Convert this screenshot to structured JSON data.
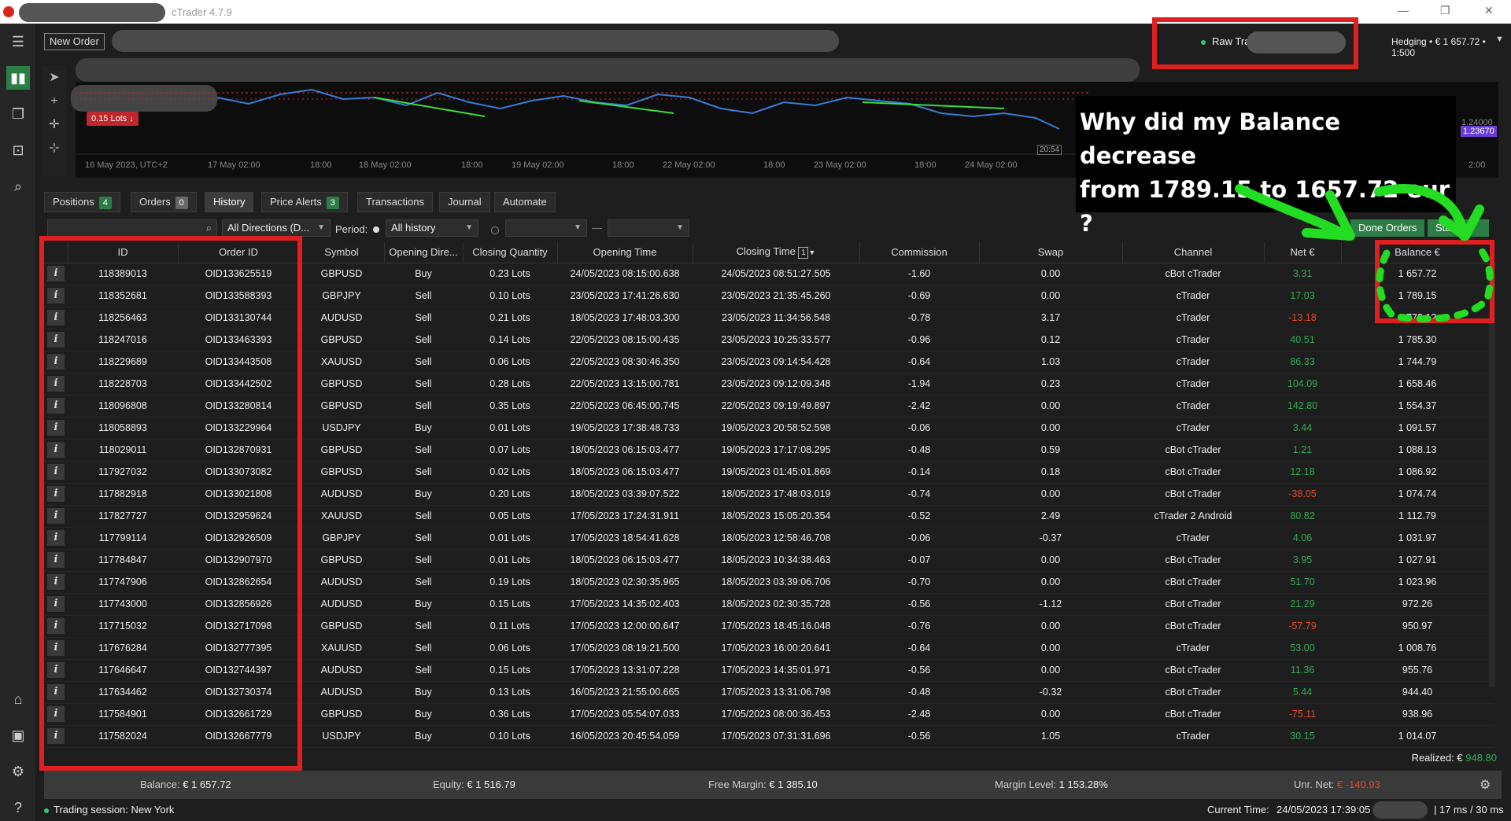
{
  "app": {
    "title": "cTrader 4.7.9"
  },
  "topbar": {
    "new_order": "New Order",
    "account_label": "Raw Trading",
    "account_suffix": "Hedging • € 1 657.72 • 1:500"
  },
  "chart": {
    "lots_badge": "0.15 Lots ↓",
    "time_labels": [
      "16 May 2023, UTC+2",
      "17 May 02:00",
      "18:00",
      "18 May 02:00",
      "18:00",
      "19 May 02:00",
      "18:00",
      "22 May 02:00",
      "18:00",
      "23 May 02:00",
      "18:00",
      "24 May 02:00"
    ],
    "price_label": "1.24000",
    "price_marker": "1.23670",
    "time_marker": "20:54",
    "axis_time_end": "2:00"
  },
  "annotation": {
    "line1": "Why did my Balance decrease",
    "line2": "from 1789.15 to 1657.72 eur ?"
  },
  "tabs": [
    {
      "label": "Positions",
      "badge": "4"
    },
    {
      "label": "Orders",
      "badge": "0"
    },
    {
      "label": "History",
      "badge": ""
    },
    {
      "label": "Price Alerts",
      "badge": "3"
    },
    {
      "label": "Transactions",
      "badge": ""
    },
    {
      "label": "Journal",
      "badge": ""
    },
    {
      "label": "Automate",
      "badge": ""
    }
  ],
  "filters": {
    "direction": "All Directions (D...",
    "period_label": "Period:",
    "period_value": "All history",
    "done_orders": "Done Orders",
    "statement": "Stateme"
  },
  "columns": [
    "ID",
    "Order ID",
    "Symbol",
    "Opening Dire...",
    "Closing Quantity",
    "Opening Time",
    "Closing Time",
    "Commission",
    "Swap",
    "Channel",
    "Net €",
    "Balance €"
  ],
  "sort_badge": "1",
  "rows": [
    [
      "118389013",
      "OID133625519",
      "GBPUSD",
      "Buy",
      "0.23 Lots",
      "24/05/2023 08:15:00.638",
      "24/05/2023 08:51:27.505",
      "-1.60",
      "0.00",
      "cBot cTrader",
      "3.31",
      "1 657.72"
    ],
    [
      "118352681",
      "OID133588393",
      "GBPJPY",
      "Sell",
      "0.10 Lots",
      "23/05/2023 17:41:26.630",
      "23/05/2023 21:35:45.260",
      "-0.69",
      "0.00",
      "cTrader",
      "17.03",
      "1 789.15"
    ],
    [
      "118256463",
      "OID133130744",
      "AUDUSD",
      "Sell",
      "0.21 Lots",
      "18/05/2023 17:48:03.300",
      "23/05/2023 11:34:56.548",
      "-0.78",
      "3.17",
      "cTrader",
      "-13.18",
      "1 772.12"
    ],
    [
      "118247016",
      "OID133463393",
      "GBPUSD",
      "Sell",
      "0.14 Lots",
      "22/05/2023 08:15:00.435",
      "23/05/2023 10:25:33.577",
      "-0.96",
      "0.12",
      "cTrader",
      "40.51",
      "1 785.30"
    ],
    [
      "118229689",
      "OID133443508",
      "XAUUSD",
      "Sell",
      "0.06 Lots",
      "22/05/2023 08:30:46.350",
      "23/05/2023 09:14:54.428",
      "-0.64",
      "1.03",
      "cTrader",
      "86.33",
      "1 744.79"
    ],
    [
      "118228703",
      "OID133442502",
      "GBPUSD",
      "Sell",
      "0.28 Lots",
      "22/05/2023 13:15:00.781",
      "23/05/2023 09:12:09.348",
      "-1.94",
      "0.23",
      "cTrader",
      "104.09",
      "1 658.46"
    ],
    [
      "118096808",
      "OID133280814",
      "GBPUSD",
      "Sell",
      "0.35 Lots",
      "22/05/2023 06:45:00.745",
      "22/05/2023 09:19:49.897",
      "-2.42",
      "0.00",
      "cTrader",
      "142.80",
      "1 554.37"
    ],
    [
      "118058893",
      "OID133229964",
      "USDJPY",
      "Buy",
      "0.01 Lots",
      "19/05/2023 17:38:48.733",
      "19/05/2023 20:58:52.598",
      "-0.06",
      "0.00",
      "cTrader",
      "3.44",
      "1 091.57"
    ],
    [
      "118029011",
      "OID132870931",
      "GBPUSD",
      "Sell",
      "0.07 Lots",
      "18/05/2023 06:15:03.477",
      "19/05/2023 17:17:08.295",
      "-0.48",
      "0.59",
      "cBot cTrader",
      "1.21",
      "1 088.13"
    ],
    [
      "117927032",
      "OID133073082",
      "GBPUSD",
      "Sell",
      "0.02 Lots",
      "18/05/2023 06:15:03.477",
      "19/05/2023 01:45:01.869",
      "-0.14",
      "0.18",
      "cBot cTrader",
      "12.18",
      "1 086.92"
    ],
    [
      "117882918",
      "OID133021808",
      "AUDUSD",
      "Buy",
      "0.20 Lots",
      "18/05/2023 03:39:07.522",
      "18/05/2023 17:48:03.019",
      "-0.74",
      "0.00",
      "cBot cTrader",
      "-38.05",
      "1 074.74"
    ],
    [
      "117827727",
      "OID132959624",
      "XAUUSD",
      "Sell",
      "0.05 Lots",
      "17/05/2023 17:24:31.911",
      "18/05/2023 15:05:20.354",
      "-0.52",
      "2.49",
      "cTrader 2 Android",
      "80.82",
      "1 112.79"
    ],
    [
      "117799114",
      "OID132926509",
      "GBPJPY",
      "Sell",
      "0.01 Lots",
      "17/05/2023 18:54:41.628",
      "18/05/2023 12:58:46.708",
      "-0.06",
      "-0.37",
      "cTrader",
      "4.06",
      "1 031.97"
    ],
    [
      "117784847",
      "OID132907970",
      "GBPUSD",
      "Sell",
      "0.01 Lots",
      "18/05/2023 06:15:03.477",
      "18/05/2023 10:34:38.463",
      "-0.07",
      "0.00",
      "cBot cTrader",
      "3.95",
      "1 027.91"
    ],
    [
      "117747906",
      "OID132862654",
      "AUDUSD",
      "Sell",
      "0.19 Lots",
      "18/05/2023 02:30:35.965",
      "18/05/2023 03:39:06.706",
      "-0.70",
      "0.00",
      "cBot cTrader",
      "51.70",
      "1 023.96"
    ],
    [
      "117743000",
      "OID132856926",
      "AUDUSD",
      "Buy",
      "0.15 Lots",
      "17/05/2023 14:35:02.403",
      "18/05/2023 02:30:35.728",
      "-0.56",
      "-1.12",
      "cBot cTrader",
      "21.29",
      "972.26"
    ],
    [
      "117715032",
      "OID132717098",
      "GBPUSD",
      "Sell",
      "0.11 Lots",
      "17/05/2023 12:00:00.647",
      "17/05/2023 18:45:16.048",
      "-0.76",
      "0.00",
      "cBot cTrader",
      "-57.79",
      "950.97"
    ],
    [
      "117676284",
      "OID132777395",
      "XAUUSD",
      "Sell",
      "0.06 Lots",
      "17/05/2023 08:19:21.500",
      "17/05/2023 16:00:20.641",
      "-0.64",
      "0.00",
      "cTrader",
      "53.00",
      "1 008.76"
    ],
    [
      "117646647",
      "OID132744397",
      "AUDUSD",
      "Sell",
      "0.15 Lots",
      "17/05/2023 13:31:07.228",
      "17/05/2023 14:35:01.971",
      "-0.56",
      "0.00",
      "cBot cTrader",
      "11.36",
      "955.76"
    ],
    [
      "117634462",
      "OID132730374",
      "AUDUSD",
      "Buy",
      "0.13 Lots",
      "16/05/2023 21:55:00.665",
      "17/05/2023 13:31:06.798",
      "-0.48",
      "-0.32",
      "cBot cTrader",
      "5.44",
      "944.40"
    ],
    [
      "117584901",
      "OID132661729",
      "GBPUSD",
      "Buy",
      "0.36 Lots",
      "17/05/2023 05:54:07.033",
      "17/05/2023 08:00:36.453",
      "-2.48",
      "0.00",
      "cBot cTrader",
      "-75.11",
      "938.96"
    ],
    [
      "117582024",
      "OID132667779",
      "USDJPY",
      "Buy",
      "0.10 Lots",
      "16/05/2023 20:45:54.059",
      "17/05/2023 07:31:31.696",
      "-0.56",
      "1.05",
      "cTrader",
      "30.15",
      "1 014.07"
    ]
  ],
  "realized": {
    "label": "Realized: €",
    "value": "948.80"
  },
  "status": {
    "balance_label": "Balance:",
    "balance": "€ 1 657.72",
    "equity_label": "Equity:",
    "equity": "€ 1 516.79",
    "free_margin_label": "Free Margin:",
    "free_margin": "€ 1 385.10",
    "margin_level_label": "Margin Level:",
    "margin_level": "1 153.28%",
    "unr_net_label": "Unr. Net:",
    "unr_net": "€ -140.93"
  },
  "footer": {
    "session": "Trading session: New York",
    "current_time_label": "Current Time:",
    "current_time": "24/05/2023 17:39:05",
    "latency": "| 17 ms / 30 ms"
  },
  "colors": {
    "positive": "#32a852",
    "negative": "#e04a2a",
    "highlight": "#e02020",
    "arrow": "#22dd22",
    "accent": "#2d7d46"
  },
  "icons": [
    "menu-icon",
    "chart-icon",
    "copy-icon",
    "robot-icon",
    "search-analysis-icon",
    "bank-icon",
    "wallet-icon",
    "gear-icon",
    "help-icon",
    "cursor-icon",
    "crosshair-icon",
    "search-icon"
  ]
}
